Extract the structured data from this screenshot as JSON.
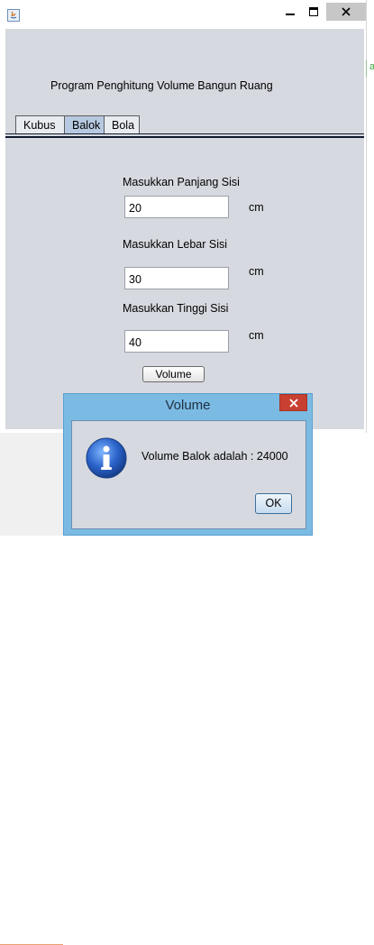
{
  "window": {
    "app_title": "Program Penghitung Volume Bangun Ruang"
  },
  "tabs": [
    {
      "label": "Kubus",
      "selected": false
    },
    {
      "label": "Balok",
      "selected": true
    },
    {
      "label": "Bola",
      "selected": false
    }
  ],
  "form": {
    "panjang": {
      "label": "Masukkan Panjang Sisi",
      "value": "20",
      "unit": "cm"
    },
    "lebar": {
      "label": "Masukkan Lebar Sisi",
      "value": "30",
      "unit": "cm"
    },
    "tinggi": {
      "label": "Masukkan Tinggi Sisi",
      "value": "40",
      "unit": "cm"
    },
    "button_label": "Volume"
  },
  "side_window": {
    "visible_text": "a"
  },
  "dialog": {
    "title": "Volume",
    "message": "Volume Balok adalah : 24000",
    "ok_label": "OK",
    "icon": "info-icon"
  },
  "colors": {
    "accent": "#7bbbe3",
    "close_red": "#c84031",
    "panel_bg": "#d6d9df",
    "selected_tab": "#b7c9e0"
  }
}
